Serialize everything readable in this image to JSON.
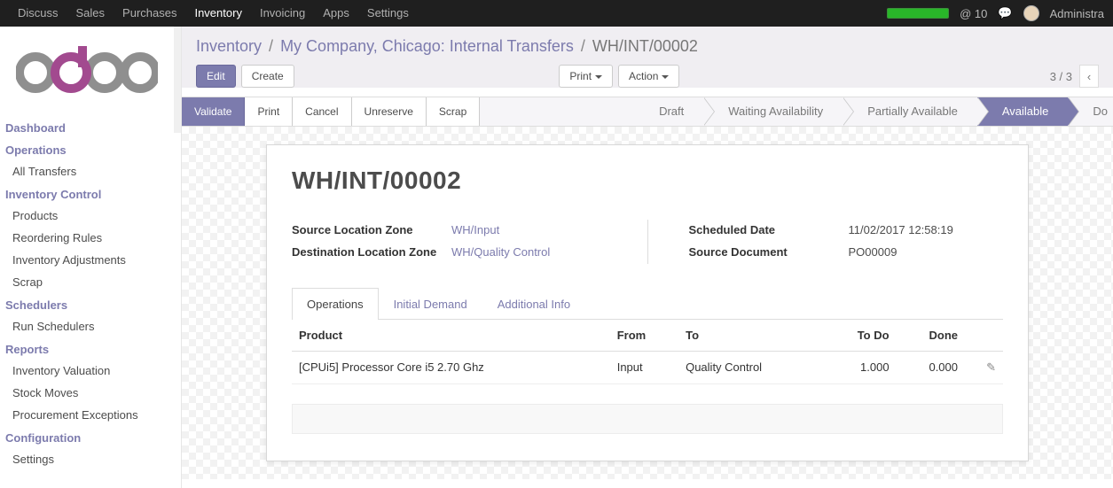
{
  "topnav": {
    "items": [
      "Discuss",
      "Sales",
      "Purchases",
      "Inventory",
      "Invoicing",
      "Apps",
      "Settings"
    ],
    "active_index": 3,
    "mail_count": "@ 10",
    "user_name": "Administra"
  },
  "sidebar": {
    "sections": [
      {
        "title": "Dashboard",
        "items": []
      },
      {
        "title": "Operations",
        "items": [
          "All Transfers"
        ]
      },
      {
        "title": "Inventory Control",
        "items": [
          "Products",
          "Reordering Rules",
          "Inventory Adjustments",
          "Scrap"
        ]
      },
      {
        "title": "Schedulers",
        "items": [
          "Run Schedulers"
        ]
      },
      {
        "title": "Reports",
        "items": [
          "Inventory Valuation",
          "Stock Moves",
          "Procurement Exceptions"
        ]
      },
      {
        "title": "Configuration",
        "items": [
          "Settings"
        ]
      }
    ]
  },
  "breadcrumb": {
    "root": "Inventory",
    "parent": "My Company, Chicago: Internal Transfers",
    "current": "WH/INT/00002"
  },
  "buttons": {
    "edit": "Edit",
    "create": "Create",
    "print": "Print",
    "action": "Action"
  },
  "pager": {
    "position": "3 / 3"
  },
  "statusbar": {
    "actions": [
      "Validate",
      "Print",
      "Cancel",
      "Unreserve",
      "Scrap"
    ],
    "states": [
      "Draft",
      "Waiting Availability",
      "Partially Available",
      "Available",
      "Do"
    ],
    "active_index": 3
  },
  "record": {
    "title": "WH/INT/00002",
    "fields_left": [
      {
        "label": "Source Location Zone",
        "value": "WH/Input",
        "link": true
      },
      {
        "label": "Destination Location Zone",
        "value": "WH/Quality Control",
        "link": true
      }
    ],
    "fields_right": [
      {
        "label": "Scheduled Date",
        "value": "11/02/2017 12:58:19",
        "link": false
      },
      {
        "label": "Source Document",
        "value": "PO00009",
        "link": false
      }
    ]
  },
  "tabs": {
    "items": [
      "Operations",
      "Initial Demand",
      "Additional Info"
    ],
    "active_index": 0
  },
  "operations": {
    "headers": [
      "Product",
      "From",
      "To",
      "To Do",
      "Done",
      ""
    ],
    "rows": [
      {
        "product": "[CPUi5] Processor Core i5 2.70 Ghz",
        "from": "Input",
        "to": "Quality Control",
        "todo": "1.000",
        "done": "0.000"
      }
    ]
  }
}
